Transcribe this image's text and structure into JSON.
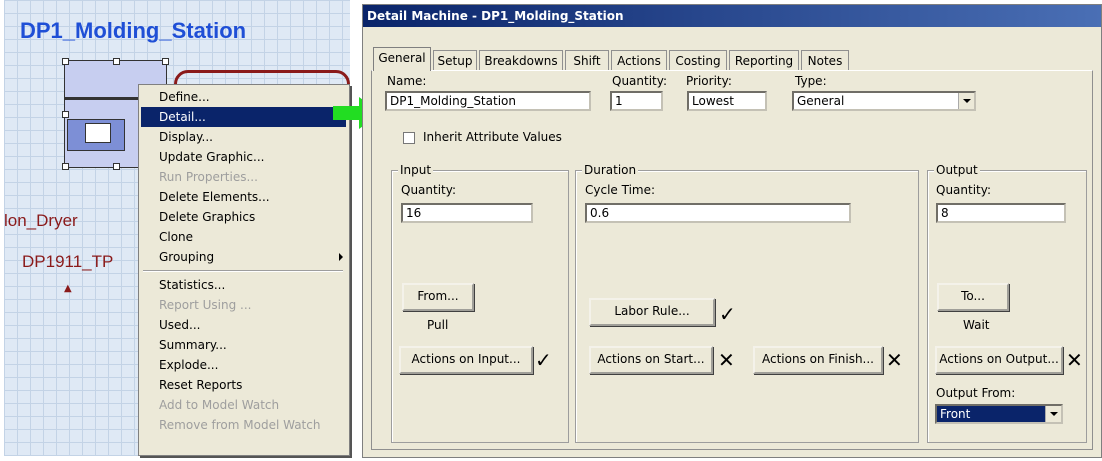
{
  "canvas": {
    "title": "DP1_Molding_Station",
    "dryer_label": "lon_Dryer",
    "tp_label": "DP1911_TP"
  },
  "context_menu": {
    "items": [
      {
        "label": "Define...",
        "state": "normal"
      },
      {
        "label": "Detail...",
        "state": "selected"
      },
      {
        "label": "Display...",
        "state": "normal"
      },
      {
        "label": "Update Graphic...",
        "state": "normal"
      },
      {
        "label": "Run Properties...",
        "state": "disabled"
      },
      {
        "label": "Delete Elements...",
        "state": "normal"
      },
      {
        "label": "Delete Graphics",
        "state": "normal"
      },
      {
        "label": "Clone",
        "state": "normal"
      },
      {
        "label": "Grouping",
        "state": "normal",
        "submenu": true
      },
      {
        "label": "Statistics...",
        "state": "normal"
      },
      {
        "label": "Report Using ...",
        "state": "disabled"
      },
      {
        "label": "Used...",
        "state": "normal"
      },
      {
        "label": "Summary...",
        "state": "normal"
      },
      {
        "label": "Explode...",
        "state": "normal"
      },
      {
        "label": "Reset Reports",
        "state": "normal"
      },
      {
        "label": "Add to Model Watch",
        "state": "disabled"
      },
      {
        "label": "Remove from Model Watch",
        "state": "disabled"
      }
    ]
  },
  "dialog": {
    "title": "Detail Machine - DP1_Molding_Station",
    "tabs": [
      "General",
      "Setup",
      "Breakdowns",
      "Shift",
      "Actions",
      "Costing",
      "Reporting",
      "Notes"
    ],
    "active_tab": "General",
    "name_label": "Name:",
    "name_value": "DP1_Molding_Station",
    "quantity_label": "Quantity:",
    "quantity_value": "1",
    "priority_label": "Priority:",
    "priority_value": "Lowest",
    "type_label": "Type:",
    "type_value": "General",
    "inherit_label": "Inherit Attribute Values",
    "inherit_checked": false,
    "input": {
      "group_title": "Input",
      "quantity_label": "Quantity:",
      "quantity_value": "16",
      "from_button": "From...",
      "pull_text": "Pull",
      "actions_button": "Actions on Input...",
      "actions_mark": "✓"
    },
    "duration": {
      "group_title": "Duration",
      "cycle_label": "Cycle Time:",
      "cycle_value": "0.6",
      "labor_button": "Labor Rule...",
      "labor_mark": "✓",
      "start_button": "Actions on Start...",
      "start_mark": "✕",
      "finish_button": "Actions on Finish...",
      "finish_mark": "✕"
    },
    "output": {
      "group_title": "Output",
      "quantity_label": "Quantity:",
      "quantity_value": "8",
      "to_button": "To...",
      "wait_text": "Wait",
      "actions_button": "Actions on Output...",
      "actions_mark": "✕",
      "output_from_label": "Output From:",
      "output_from_value": "Front"
    }
  },
  "colors": {
    "title_blue": "#1f4fd6",
    "dark_red": "#8a1a1a",
    "selection": "#0a246a",
    "dialog_bg": "#ece9d8",
    "arrow_green": "#22dd22"
  }
}
